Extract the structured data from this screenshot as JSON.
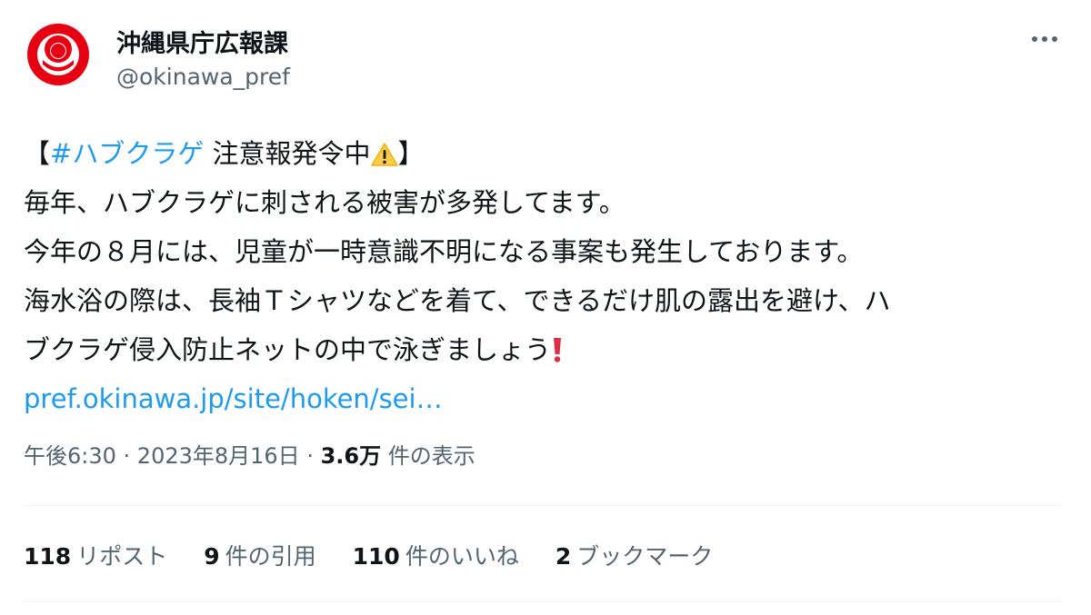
{
  "author": {
    "display_name": "沖縄県庁広報課",
    "handle": "@okinawa_pref",
    "avatar_icon": "okinawa-pref-emblem-icon",
    "brand_color": "#e60012"
  },
  "more_icon": "more-horizontal-icon",
  "tweet": {
    "bracket_open": "【",
    "hashtag": "#ハブクラゲ",
    "headline_rest": " 注意報発令中",
    "warning_icon": "warning-icon",
    "bracket_close": "】",
    "line2": "毎年、ハブクラゲに刺される被害が多発してます。",
    "line3": "今年の８月には、児童が一時意識不明になる事案も発生しております。",
    "line4": "海水浴の際は、長袖Ｔシャツなどを着て、できるだけ肌の露出を避け、ハ",
    "line5": "ブクラゲ侵入防止ネットの中で泳ぎましょう",
    "exclamation_icon": "red-exclamation-icon",
    "link_text": "pref.okinawa.jp/site/hoken/sei…",
    "link_color": "#1d9bf0"
  },
  "meta": {
    "time": "午後6:30",
    "separator1": " · ",
    "date": "2023年8月16日",
    "separator2": " · ",
    "views_count": "3.6万",
    "views_label": " 件の表示"
  },
  "stats": [
    {
      "count": "118",
      "label": "リポスト"
    },
    {
      "count": "9",
      "label": "件の引用"
    },
    {
      "count": "110",
      "label": "件のいいね"
    },
    {
      "count": "2",
      "label": "ブックマーク"
    }
  ]
}
